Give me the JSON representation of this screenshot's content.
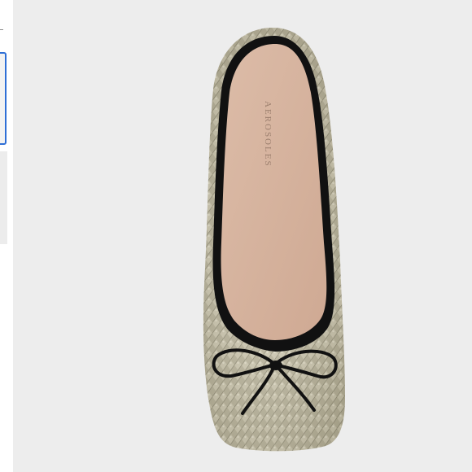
{
  "gallery": {
    "selected_index": 1,
    "thumbnail_count": 3
  },
  "product_image": {
    "brand_stamp": "AEROSOLES",
    "colors": {
      "background": "#ededed",
      "upper": "#b9b39a",
      "binding": "#111111",
      "insole": "#d6b4a0",
      "selected_border": "#2f6fd6"
    }
  }
}
